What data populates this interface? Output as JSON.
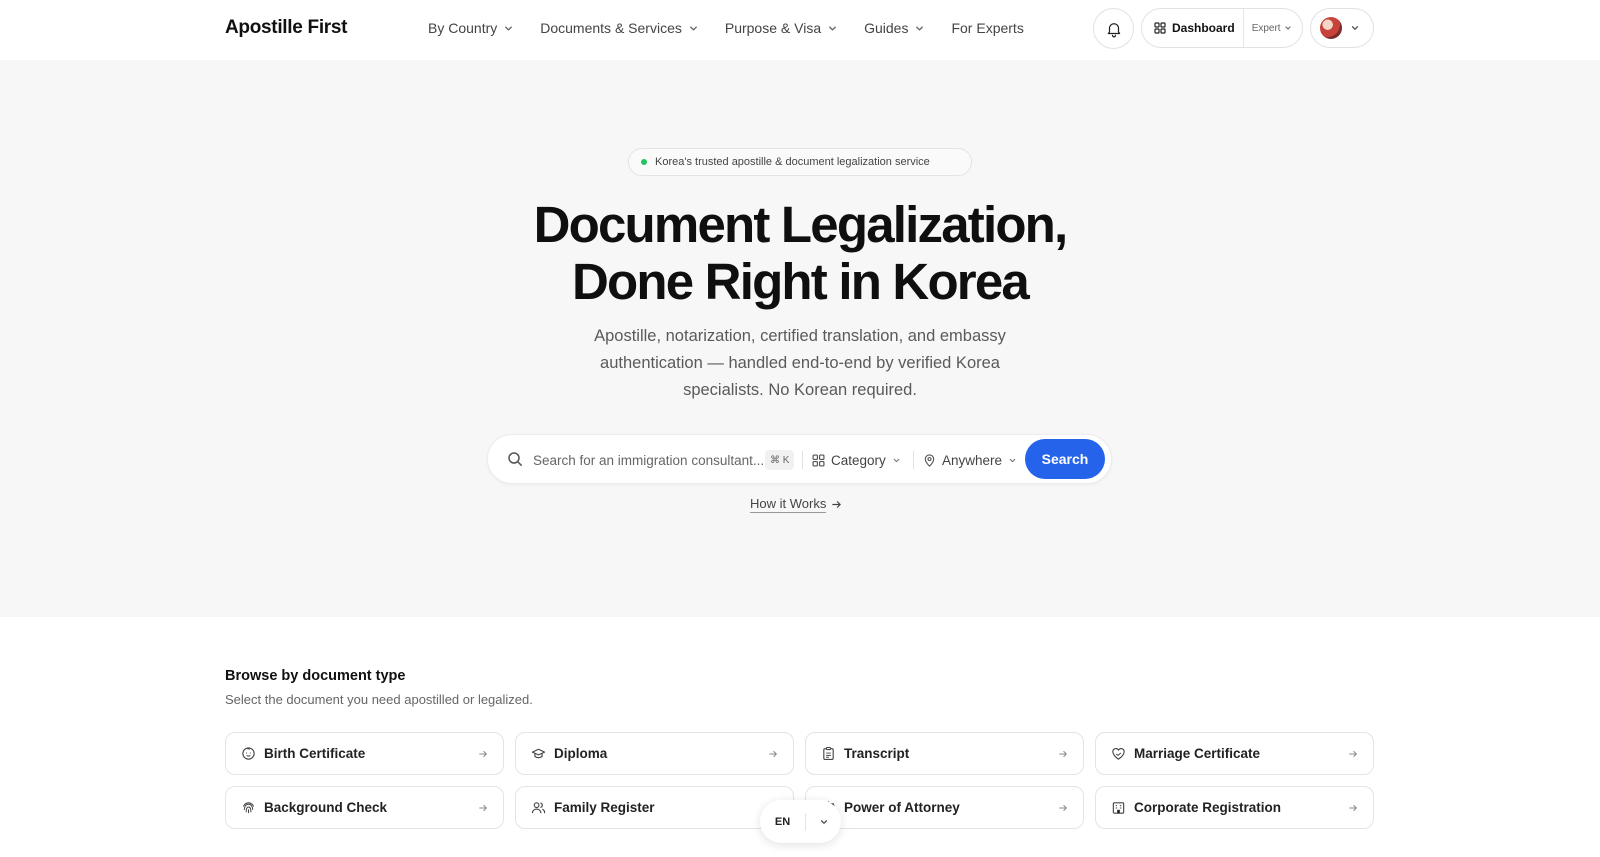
{
  "brand": {
    "name": "Apostille First"
  },
  "nav": {
    "items": [
      {
        "label": "By Country",
        "has_dropdown": true
      },
      {
        "label": "Documents & Services",
        "has_dropdown": true
      },
      {
        "label": "Purpose & Visa",
        "has_dropdown": true
      },
      {
        "label": "Guides",
        "has_dropdown": true
      },
      {
        "label": "For Experts",
        "has_dropdown": false
      }
    ]
  },
  "header": {
    "notifications_icon": "bell-icon",
    "dashboard_label": "Dashboard",
    "role_label": "Expert",
    "user_avatar": "avatar"
  },
  "hero": {
    "badge": "Korea's trusted apostille & document legalization service",
    "badge_dot_color": "#22c55e",
    "title_line1": "Document Legalization,",
    "title_line2": "Done Right in Korea",
    "subtitle": "Apostille, notarization, certified translation, and embassy authentication — handled end-to-end by verified Korea specialists. No Korean required."
  },
  "search": {
    "placeholder": "Search for an immigration consultant...",
    "shortcut": "⌘ K",
    "category_label": "Category",
    "location_label": "Anywhere",
    "button_label": "Search",
    "accent_color": "#2563eb"
  },
  "how_it_works": {
    "label": "How it Works"
  },
  "browse": {
    "title": "Browse by document type",
    "subtitle": "Select the document you need apostilled or legalized.",
    "items": [
      {
        "label": "Birth Certificate",
        "icon": "baby-icon"
      },
      {
        "label": "Diploma",
        "icon": "graduation-cap-icon"
      },
      {
        "label": "Transcript",
        "icon": "clipboard-icon"
      },
      {
        "label": "Marriage Certificate",
        "icon": "heart-handshake-icon"
      },
      {
        "label": "Background Check",
        "icon": "fingerprint-icon"
      },
      {
        "label": "Family Register",
        "icon": "users-icon"
      },
      {
        "label": "Power of Attorney",
        "icon": "scale-icon"
      },
      {
        "label": "Corporate Registration",
        "icon": "building-icon"
      }
    ]
  },
  "language": {
    "code": "EN"
  }
}
